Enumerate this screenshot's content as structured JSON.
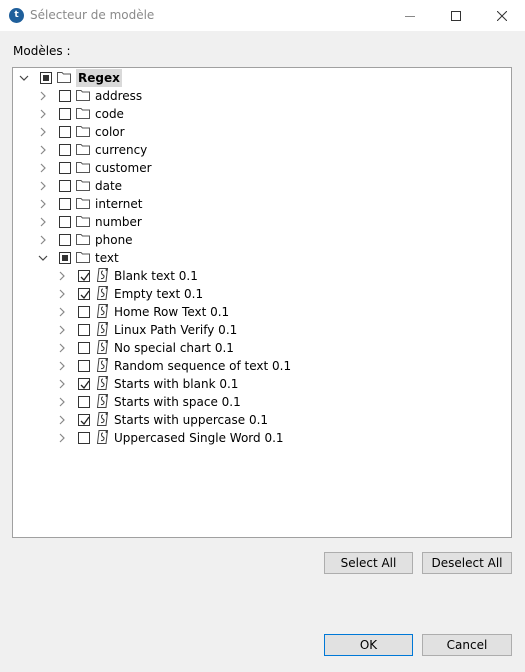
{
  "window": {
    "title": "Sélecteur de modèle",
    "app_icon_glyph": "t"
  },
  "models_label": "Modèles :",
  "tree": {
    "root": {
      "label": "Regex",
      "state": "partial",
      "expanded": true
    },
    "folders": [
      {
        "label": "address",
        "state": "unchecked",
        "expanded": false
      },
      {
        "label": "code",
        "state": "unchecked",
        "expanded": false
      },
      {
        "label": "color",
        "state": "unchecked",
        "expanded": false
      },
      {
        "label": "currency",
        "state": "unchecked",
        "expanded": false
      },
      {
        "label": "customer",
        "state": "unchecked",
        "expanded": false
      },
      {
        "label": "date",
        "state": "unchecked",
        "expanded": false
      },
      {
        "label": "internet",
        "state": "unchecked",
        "expanded": false
      },
      {
        "label": "number",
        "state": "unchecked",
        "expanded": false
      },
      {
        "label": "phone",
        "state": "unchecked",
        "expanded": false
      },
      {
        "label": "text",
        "state": "partial",
        "expanded": true
      }
    ],
    "text_items": [
      {
        "label": "Blank text 0.1",
        "checked": true
      },
      {
        "label": "Empty text 0.1",
        "checked": true
      },
      {
        "label": "Home Row Text 0.1",
        "checked": false
      },
      {
        "label": "Linux Path Verify 0.1",
        "checked": false
      },
      {
        "label": "No special chart 0.1",
        "checked": false
      },
      {
        "label": "Random sequence of text 0.1",
        "checked": false
      },
      {
        "label": "Starts with blank 0.1",
        "checked": true
      },
      {
        "label": "Starts with space 0.1",
        "checked": false
      },
      {
        "label": "Starts with uppercase 0.1",
        "checked": true
      },
      {
        "label": "Uppercased Single Word 0.1",
        "checked": false
      }
    ]
  },
  "buttons": {
    "select_all": "Select All",
    "deselect_all": "Deselect All",
    "ok": "OK",
    "cancel": "Cancel"
  },
  "icons": {
    "folder": "folder-icon",
    "pattern": "regex-pattern-icon",
    "expand": "chevron-right-icon",
    "collapse": "chevron-down-icon"
  }
}
